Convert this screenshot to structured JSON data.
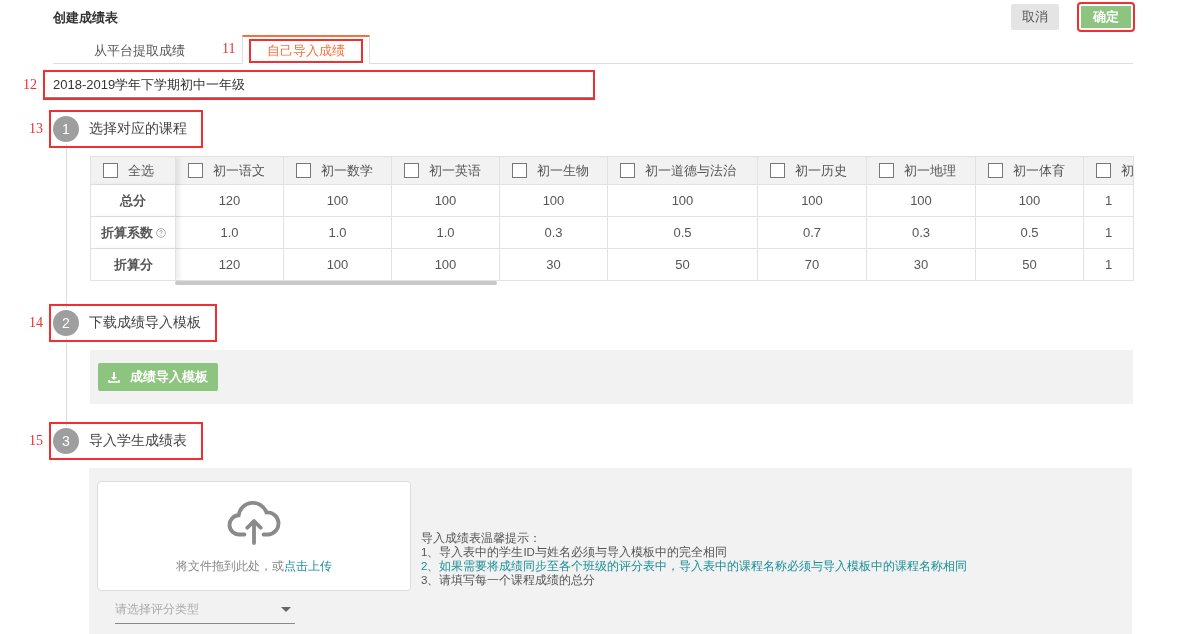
{
  "header": {
    "title": "创建成绩表",
    "buttons": [
      {
        "label": "取消",
        "kind": "secondary",
        "highlighted": false
      },
      {
        "label": "确定",
        "kind": "primary",
        "highlighted": true
      }
    ]
  },
  "tabs": [
    {
      "label": "从平台提取成绩",
      "selected": false,
      "highlighted": false
    },
    {
      "label": "自己导入成绩",
      "selected": true,
      "highlighted": true,
      "marker": "11"
    }
  ],
  "name_field": {
    "value": "2018-2019学年下学期初中一年级",
    "highlighted": true,
    "marker": "12"
  },
  "steps": [
    {
      "number": "1",
      "title": "选择对应的课程",
      "highlighted": true,
      "marker": "13",
      "kind": "courses",
      "table": {
        "select_all": {
          "label": "全选",
          "checked": false
        },
        "columns": [
          {
            "label": "初一语文",
            "checked": false
          },
          {
            "label": "初一数学",
            "checked": false
          },
          {
            "label": "初一英语",
            "checked": false
          },
          {
            "label": "初一生物",
            "checked": false
          },
          {
            "label": "初一道德与法治",
            "checked": false
          },
          {
            "label": "初一历史",
            "checked": false
          },
          {
            "label": "初一地理",
            "checked": false
          },
          {
            "label": "初一体育",
            "checked": false
          },
          {
            "label": "初",
            "checked": false
          }
        ],
        "rows": [
          {
            "label": "总分",
            "help": false,
            "values": [
              "120",
              "100",
              "100",
              "100",
              "100",
              "100",
              "100",
              "100",
              "1"
            ]
          },
          {
            "label": "折算系数",
            "help": true,
            "values": [
              "1.0",
              "1.0",
              "1.0",
              "0.3",
              "0.5",
              "0.7",
              "0.3",
              "0.5",
              "1"
            ]
          },
          {
            "label": "折算分",
            "help": false,
            "values": [
              "120",
              "100",
              "100",
              "30",
              "50",
              "70",
              "30",
              "50",
              "1"
            ]
          }
        ]
      }
    },
    {
      "number": "2",
      "title": "下载成绩导入模板",
      "highlighted": true,
      "marker": "14",
      "kind": "template",
      "download_button": {
        "label": "成绩导入模板"
      }
    },
    {
      "number": "3",
      "title": "导入学生成绩表",
      "highlighted": true,
      "marker": "15",
      "kind": "upload",
      "upload": {
        "prompt": "将文件拖到此处，或",
        "link": "点击上传"
      },
      "type_select": {
        "placeholder": "请选择评分类型"
      },
      "tips": {
        "title": "导入成绩表温馨提示：",
        "items": [
          {
            "text": "1、导入表中的学生ID与姓名必须与导入模板中的完全相同",
            "kind": "normal"
          },
          {
            "text": "2、如果需要将成绩同步至各个班级的评分表中，导入表中的课程名称必须与导入模板中的课程名称相同",
            "kind": "emphasis"
          },
          {
            "text": "3、请填写每一个课程成绩的总分",
            "kind": "normal"
          }
        ]
      }
    }
  ]
}
